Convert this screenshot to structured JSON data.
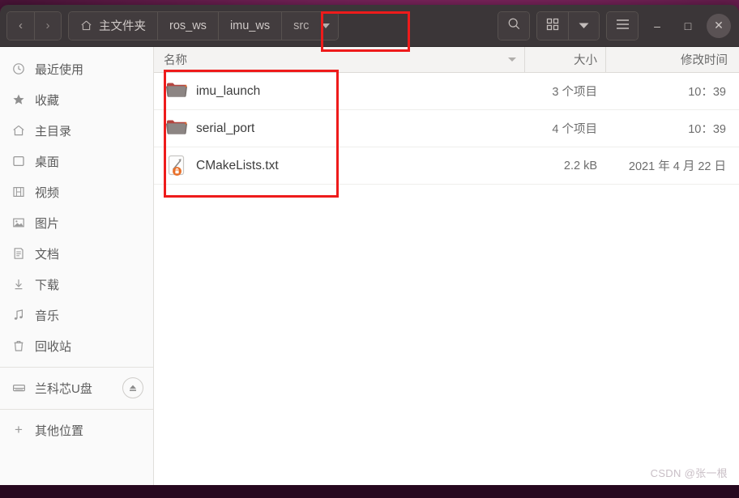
{
  "window": {
    "nav": {
      "back_label": "‹",
      "forward_label": "›"
    },
    "breadcrumbs": [
      {
        "label": "主文件夹",
        "icon": "home-icon",
        "has_caret": false
      },
      {
        "label": "ros_ws",
        "icon": "",
        "has_caret": false
      },
      {
        "label": "imu_ws",
        "icon": "",
        "has_caret": false
      },
      {
        "label": "src",
        "icon": "",
        "has_caret": true
      }
    ],
    "toolbar": {
      "search_label": "search-icon",
      "view_grid_label": "grid-view-icon",
      "view_dropdown_label": "chevron-down-icon",
      "menu_label": "hamburger-menu-icon"
    },
    "controls": {
      "minimize": "–",
      "maximize": "□",
      "close": "✕"
    }
  },
  "sidebar": {
    "items": [
      {
        "label": "最近使用",
        "icon": "clock-icon"
      },
      {
        "label": "收藏",
        "icon": "star-icon"
      },
      {
        "label": "主目录",
        "icon": "home-icon"
      },
      {
        "label": "桌面",
        "icon": "desktop-icon"
      },
      {
        "label": "视频",
        "icon": "video-icon"
      },
      {
        "label": "图片",
        "icon": "image-icon"
      },
      {
        "label": "文档",
        "icon": "document-icon"
      },
      {
        "label": "下载",
        "icon": "download-icon"
      },
      {
        "label": "音乐",
        "icon": "music-icon"
      },
      {
        "label": "回收站",
        "icon": "trash-icon"
      }
    ],
    "devices": [
      {
        "label": "兰科芯U盘",
        "icon": "drive-icon",
        "eject": "eject-icon"
      }
    ],
    "other": {
      "label": "其他位置",
      "icon": "plus-icon"
    }
  },
  "filelist": {
    "columns": {
      "name": "名称",
      "size": "大小",
      "date": "修改时间"
    },
    "rows": [
      {
        "name": "imu_launch",
        "type": "folder",
        "size": "3 个项目",
        "date": "10：39"
      },
      {
        "name": "serial_port",
        "type": "folder",
        "size": "4 个项目",
        "date": "10：39"
      },
      {
        "name": "CMakeLists.txt",
        "type": "cmake-locked",
        "size": "2.2 kB",
        "date": "2021 年 4 月 22 日"
      }
    ]
  },
  "watermark": {
    "text": "CSDN @张一根"
  },
  "colors": {
    "headerbar": "#3b3638",
    "annotation": "#ee1b1b",
    "sidebar_bg": "#fafafa",
    "desktop": "#5d1a46",
    "folder_tab": "#b5453f",
    "lock_badge": "#e8702a"
  }
}
